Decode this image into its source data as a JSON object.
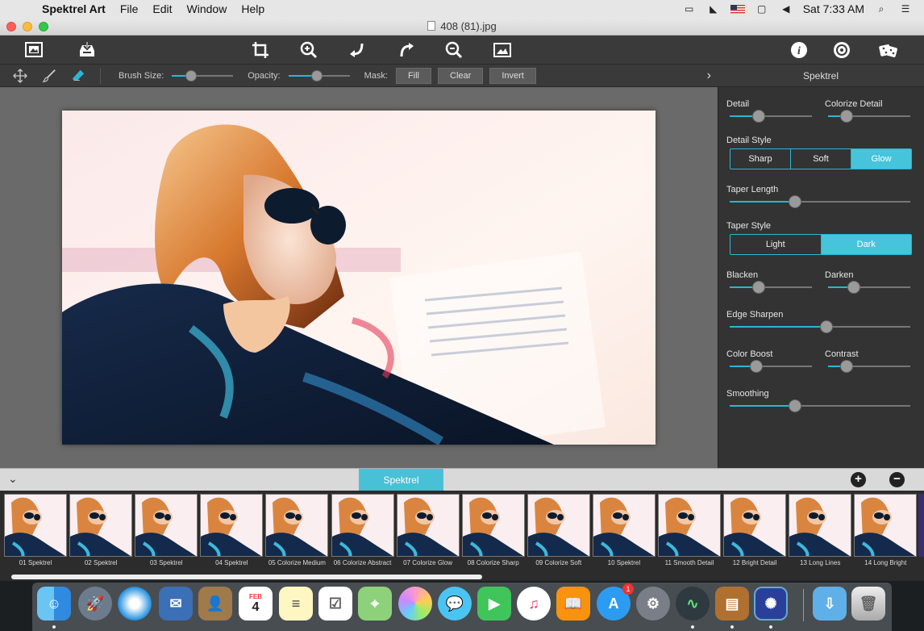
{
  "menubar": {
    "app_name": "Spektrel Art",
    "items": [
      "File",
      "Edit",
      "Window",
      "Help"
    ],
    "clock": "Sat 7:33 AM"
  },
  "window": {
    "title": "408 (81).jpg"
  },
  "brushbar": {
    "brush_size_label": "Brush Size:",
    "brush_size_value": 0.28,
    "opacity_label": "Opacity:",
    "opacity_value": 0.45,
    "mask_label": "Mask:",
    "mask_buttons": [
      "Fill",
      "Clear",
      "Invert"
    ]
  },
  "panel": {
    "title": "Spektrel",
    "detail_label": "Detail",
    "colorize_detail_label": "Colorize Detail",
    "detail_style_label": "Detail Style",
    "detail_styles": [
      "Sharp",
      "Soft",
      "Glow"
    ],
    "detail_style_selected": "Glow",
    "taper_length_label": "Taper Length",
    "taper_style_label": "Taper Style",
    "taper_styles": [
      "Light",
      "Dark"
    ],
    "taper_style_selected": "Dark",
    "blacken_label": "Blacken",
    "darken_label": "Darken",
    "edge_sharpen_label": "Edge Sharpen",
    "color_boost_label": "Color Boost",
    "contrast_label": "Contrast",
    "smoothing_label": "Smoothing",
    "levels": {
      "detail": 0.33,
      "colorize_detail": 0.17,
      "taper_length": 0.35,
      "blacken": 0.33,
      "darken": 0.28,
      "edge_sharpen": 0.54,
      "color_boost": 0.29,
      "contrast": 0.18,
      "smoothing": 0.35
    },
    "accent_color": "#2ab6d4"
  },
  "strip": {
    "tab_label": "Spektrel",
    "presets": [
      "01 Spektrel",
      "02 Spektrel",
      "03 Spektrel",
      "04 Spektrel",
      "05 Colorize Medium",
      "06 Colorize Abstract",
      "07 Colorize Glow",
      "08 Colorize Sharp",
      "09 Colorize Soft",
      "10 Spektrel",
      "11 Smooth Detail",
      "12 Bright Detail",
      "13 Long Lines",
      "14 Long Bright"
    ]
  },
  "dock": {
    "calendar_month": "FEB",
    "calendar_day": "4",
    "app_store_badge": "1",
    "icons": [
      "finder-icon",
      "launchpad-icon",
      "safari-icon",
      "mail-icon",
      "contacts-icon",
      "calendar-icon",
      "notes-icon",
      "reminders-icon",
      "maps-icon",
      "photos-icon",
      "messages-icon",
      "facetime-icon",
      "itunes-icon",
      "ibooks-icon",
      "app-store-icon",
      "system-preferences-icon",
      "activity-monitor-icon",
      "archive-utility-icon",
      "spektrel-art-icon",
      "downloads-folder-icon",
      "trash-icon"
    ]
  }
}
